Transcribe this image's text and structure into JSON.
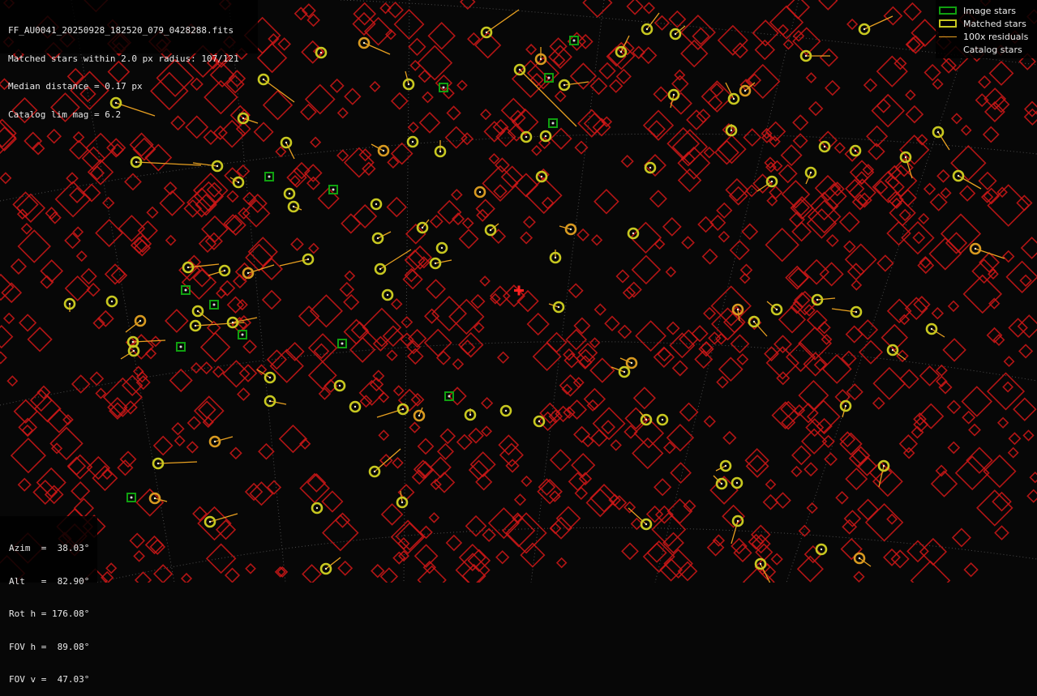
{
  "header": {
    "lines": [
      "FF_AU0041_20250928_182520_079_0428288.fits",
      "Matched stars within 2.0 px radius: 107/121",
      "Median distance = 0.17 px",
      "Catalog lim mag = 6.2"
    ]
  },
  "legend": {
    "items": [
      {
        "label": "Image stars"
      },
      {
        "label": "Matched stars"
      },
      {
        "label": "100x residuals"
      },
      {
        "label": "Catalog stars"
      }
    ]
  },
  "pointing": {
    "lines": [
      "Azim  =  38.03°",
      "Alt   =  82.90°",
      "Rot h = 176.08°",
      "FOV h =  89.08°",
      "FOV v =  47.03°"
    ]
  },
  "colors": {
    "background": "#070707",
    "catalog_stars": "#d01818",
    "matched_stars": "#c8c820",
    "residuals": "#e8a020",
    "image_stars": "#10a010",
    "center_marker": "#ff2020",
    "grid": "#6a6a6a"
  }
}
